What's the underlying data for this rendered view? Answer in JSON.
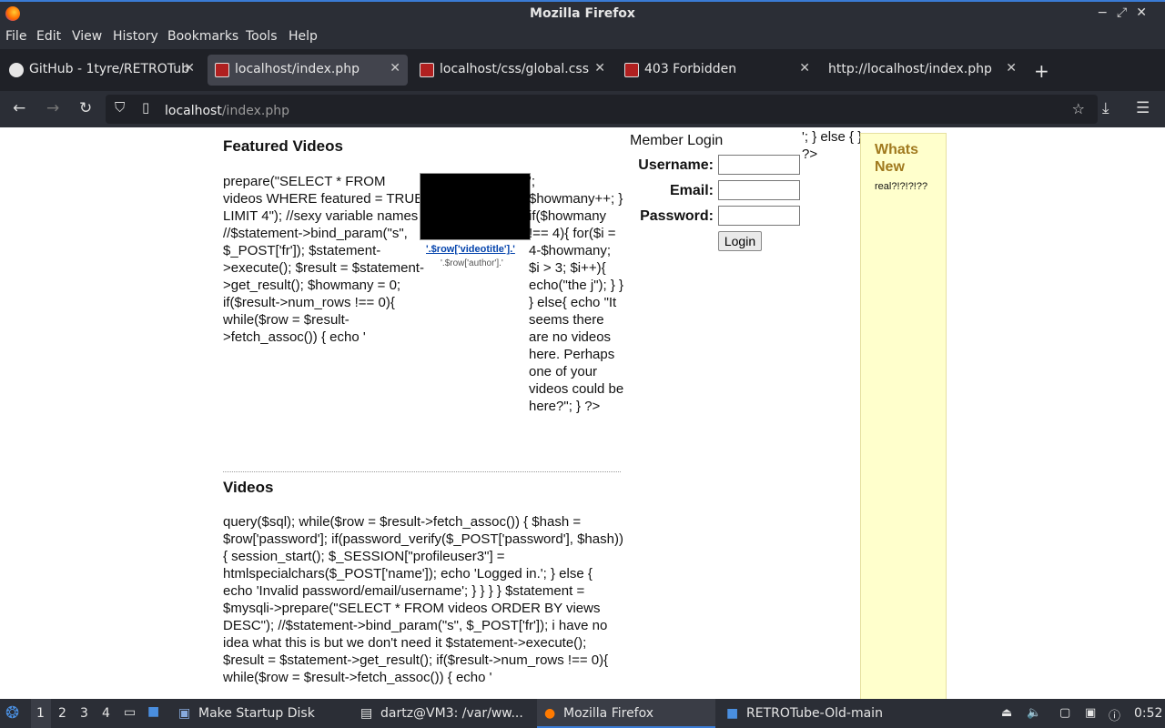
{
  "window": {
    "title": "Mozilla Firefox"
  },
  "menu": [
    "File",
    "Edit",
    "View",
    "History",
    "Bookmarks",
    "Tools",
    "Help"
  ],
  "tabs": [
    {
      "label": "GitHub - 1tyre/RETROTub"
    },
    {
      "label": "localhost/index.php"
    },
    {
      "label": "localhost/css/global.css"
    },
    {
      "label": "403 Forbidden"
    },
    {
      "label": "http://localhost/index.php"
    }
  ],
  "nav": {
    "url_host": "localhost",
    "url_path": "/index.php"
  },
  "page": {
    "featured_heading": "Featured Videos",
    "featured_code_left": "prepare(\"SELECT * FROM videos WHERE featured = TRUE LIMIT 4\"); //sexy variable names //$statement->bind_param(\"s\", $_POST['fr']); $statement->execute(); $result = $statement->get_result(); $howmany = 0; if($result->num_rows !== 0){ while($row = $result->fetch_assoc()) { echo '",
    "featured_code_right": "'; $howmany++; } if($howmany !== 4){ for($i = 4-$howmany; $i > 3; $i++){ echo(\"the j\"); } } } else{ echo \"It seems there are no videos here. Perhaps one of your videos could be here?\"; } ?>",
    "video_title": "'.$row['videotitle'].'",
    "video_author": "'.$row['author'].'",
    "videos_heading": "Videos",
    "videos_code": "query($sql); while($row = $result->fetch_assoc()) { $hash = $row['password']; if(password_verify($_POST['password'], $hash)){ session_start(); $_SESSION[\"profileuser3\"] = htmlspecialchars($_POST['name']); echo 'Logged in.'; } else { echo 'Invalid password/email/username'; } } } } $statement = $mysqli->prepare(\"SELECT * FROM videos ORDER BY views DESC\"); //$statement->bind_param(\"s\", $_POST['fr']); i have no idea what this is but we don't need it $statement->execute(); $result = $statement->get_result(); if($result->num_rows !== 0){ while($row = $result->fetch_assoc()) { echo '",
    "login_title": "Member Login",
    "username_label": "Username:",
    "email_label": "Email:",
    "password_label": "Password:",
    "login_button": "Login",
    "else_code": "'; } else { } ?>",
    "news_title": "Whats New",
    "news_body": "real?!?!?!??"
  },
  "taskbar": {
    "workspaces": [
      "1",
      "2",
      "3",
      "4"
    ],
    "items": [
      "Make Startup Disk",
      "dartz@VM3: /var/ww...",
      "Mozilla Firefox",
      "RETROTube-Old-main"
    ],
    "clock": "0:52"
  }
}
